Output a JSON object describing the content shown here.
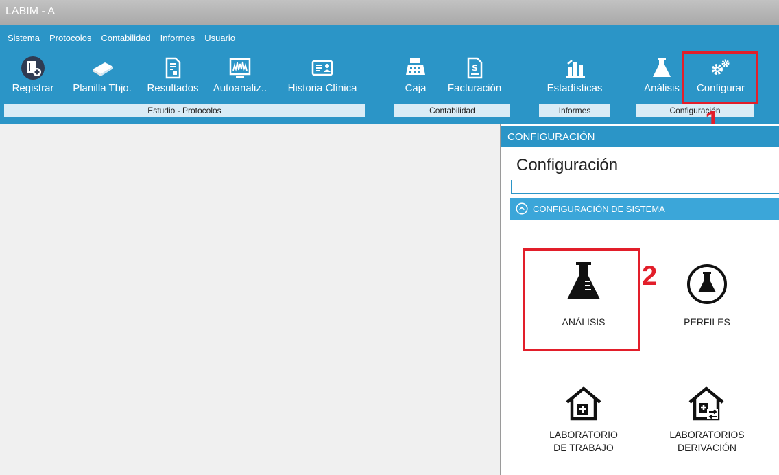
{
  "window": {
    "title": "LABIM - A"
  },
  "menu": [
    "Sistema",
    "Protocolos",
    "Contabilidad",
    "Informes",
    "Usuario"
  ],
  "toolbar": {
    "registrar": "Registrar",
    "planilla": "Planilla Tbjo.",
    "resultados": "Resultados",
    "autoanaliz": "Autoanaliz..",
    "historia": "Historia Clínica",
    "caja": "Caja",
    "facturacion": "Facturación",
    "estadisticas": "Estadísticas",
    "analisis": "Análisis",
    "configurar": "Configurar"
  },
  "groups": {
    "estudio": "Estudio - Protocolos",
    "contabilidad": "Contabilidad",
    "informes": "Informes",
    "configuracion": "Configuración"
  },
  "annotations": {
    "one": "1",
    "two": "2"
  },
  "panel": {
    "header": "CONFIGURACIÓN",
    "title": "Configuración",
    "section": "CONFIGURACIÓN DE SISTEMA",
    "tiles": {
      "analisis": "ANÁLISIS",
      "perfiles": "PERFILES",
      "lab_trabajo_1": "LABORATORIO",
      "lab_trabajo_2": "DE TRABAJO",
      "lab_deriv_1": "LABORATORIOS",
      "lab_deriv_2": "DERIVACIÓN"
    }
  },
  "colors": {
    "ribbon": "#2b95c7",
    "group_bar": "#d9ecf6",
    "annotation": "#e21e2a",
    "section": "#3ba6d9"
  }
}
